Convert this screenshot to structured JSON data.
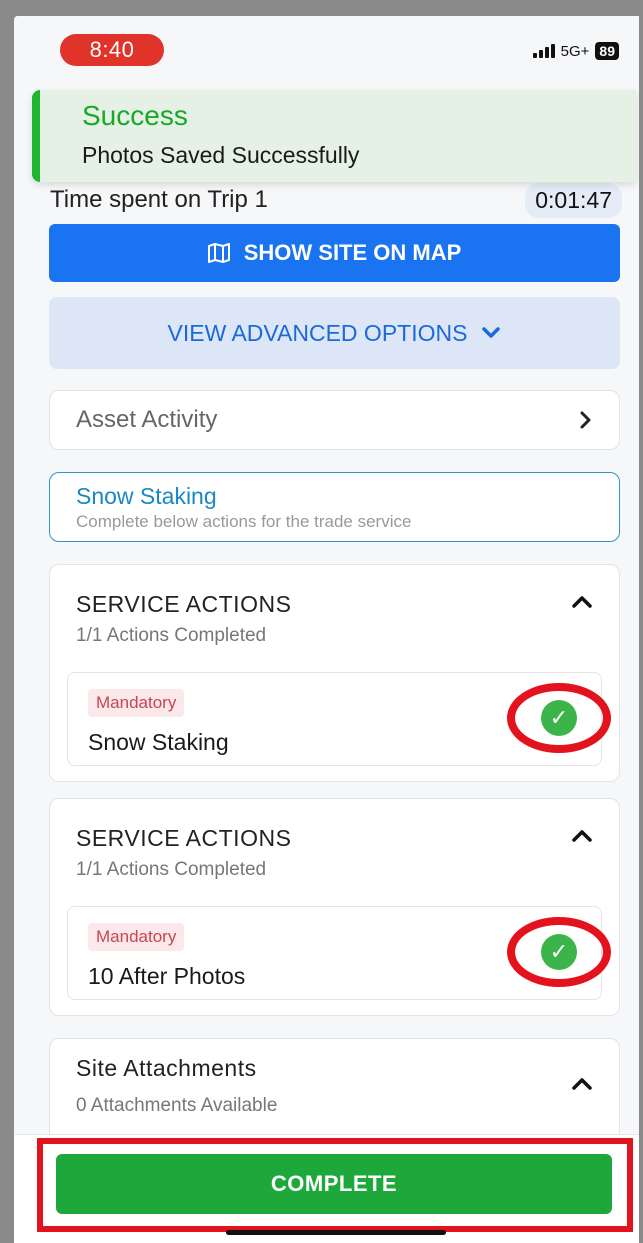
{
  "status_bar": {
    "time": "8:40",
    "network": "5G+",
    "battery": "89"
  },
  "toast": {
    "title": "Success",
    "message": "Photos Saved Successfully"
  },
  "trip": {
    "label": "Time spent on Trip 1",
    "elapsed": "0:01:47"
  },
  "buttons": {
    "show_map": "SHOW SITE ON MAP",
    "advanced": "VIEW ADVANCED OPTIONS",
    "complete": "COMPLETE"
  },
  "asset_activity": {
    "label": "Asset Activity"
  },
  "trade_service": {
    "title": "Snow Staking",
    "subtitle": "Complete below actions for the trade service"
  },
  "sections": [
    {
      "title": "SERVICE ACTIONS",
      "subtitle": "1/1 Actions Completed",
      "badge": "Mandatory",
      "action": "Snow Staking"
    },
    {
      "title": "SERVICE ACTIONS",
      "subtitle": "1/1 Actions Completed",
      "badge": "Mandatory",
      "action": "10 After Photos"
    }
  ],
  "attachments": {
    "title": "Site Attachments",
    "subtitle": "0 Attachments Available"
  },
  "colors": {
    "primary_blue": "#1a73f0",
    "success_green": "#1ea83b",
    "highlight_red": "#e3131e"
  }
}
